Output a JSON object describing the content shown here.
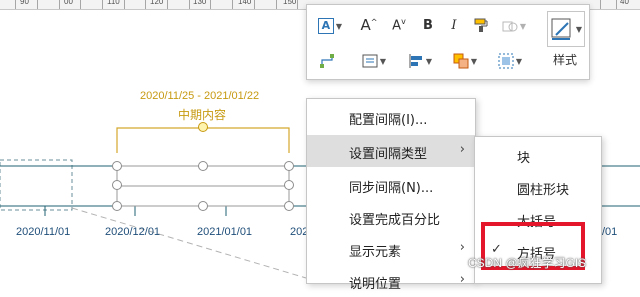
{
  "ruler": {
    "labels": [
      "90",
      "00",
      "110",
      "120",
      "130",
      "140",
      "150",
      "40"
    ]
  },
  "timeline": {
    "period": {
      "date_range": "2020/11/25 - 2021/01/22",
      "label": "中期内容",
      "color": "#c79a12"
    },
    "ticks": [
      "2020/11/01",
      "2020/12/01",
      "2021/01/01",
      "202",
      "/01"
    ],
    "line_color": "#1f6070"
  },
  "toolbar": {
    "style_label": "样式",
    "bold_label": "B",
    "italic_label": "I",
    "grow_font_label": "A",
    "shrink_font_label": "A",
    "icons": [
      "text-box-icon",
      "grow-font-icon",
      "shrink-font-icon",
      "bold-icon",
      "italic-icon",
      "format-painter-icon",
      "shape-fill-icon",
      "style-icon",
      "connector-icon",
      "align-center-icon",
      "align-left-icon",
      "arrange-icon"
    ]
  },
  "context_menu": {
    "items": [
      {
        "label": "配置间隔(I)...",
        "has_submenu": false
      },
      {
        "label": "设置间隔类型",
        "has_submenu": true
      },
      {
        "label": "同步间隔(N)...",
        "has_submenu": false
      },
      {
        "label": "设置完成百分比",
        "has_submenu": false
      },
      {
        "label": "显示元素",
        "has_submenu": true
      },
      {
        "label": "说明位置",
        "has_submenu": true
      }
    ]
  },
  "submenu": {
    "items": [
      {
        "label": "块",
        "checked": false
      },
      {
        "label": "圆柱形块",
        "checked": false
      },
      {
        "label": "大括号",
        "checked": false
      },
      {
        "label": "方括号",
        "checked": true
      }
    ]
  },
  "watermark": "CSDN @疯狂学习GIS",
  "colors": {
    "highlight": "#e3162b",
    "menu_hover": "#dedede"
  }
}
